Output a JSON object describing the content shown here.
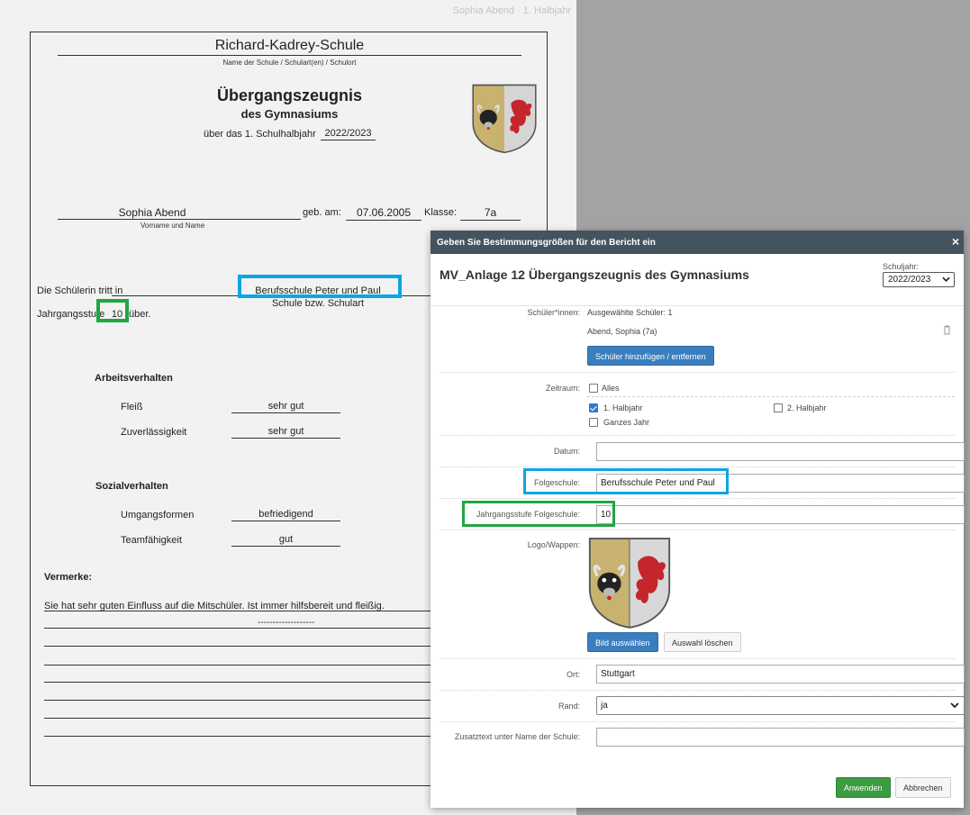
{
  "page_header": "Sophia Abend · 1. Halbjahr",
  "report": {
    "school_name": "Richard-Kadrey-Schule",
    "school_caption": "Name der Schule / Schulart(en) / Schulort",
    "title": "Übergangszeugnis",
    "subtitle": "des Gymnasiums",
    "period_label": "über das 1. Schulhalbjahr",
    "period_value": "2022/2023",
    "student_name": "Sophia Abend",
    "name_caption": "Vorname und Name",
    "birth_label": "geb. am:",
    "birth_value": "07.06.2005",
    "class_label": "Klasse:",
    "class_value": "7a",
    "transfer_label": "Die Schülerin tritt in",
    "transfer_school": "Berufsschule Peter und Paul",
    "transfer_caption": "Schule bzw. Schulart",
    "grade_label": "Jahrgangsstufe",
    "grade_value": "10",
    "grade_suffix": "über.",
    "work_heading": "Arbeitsverhalten",
    "work_items": [
      {
        "label": "Fleiß",
        "value": "sehr gut"
      },
      {
        "label": "Zuverlässigkeit",
        "value": "sehr gut"
      }
    ],
    "social_heading": "Sozialverhalten",
    "social_items": [
      {
        "label": "Umgangsformen",
        "value": "befriedigend"
      },
      {
        "label": "Teamfähigkeit",
        "value": "gut"
      }
    ],
    "remarks_heading": "Vermerke:",
    "remarks_text": "Sie hat sehr guten Einfluss auf die Mitschüler. Ist immer hilfsbereit und fleißig.",
    "remarks_dashes": "-------------------"
  },
  "dialog": {
    "bar_title": "Geben Sie Bestimmungsgrößen für den Bericht ein",
    "close_glyph": "×",
    "title": "MV_Anlage 12 Übergangszeugnis des Gymnasiums",
    "schuljahr_label": "Schuljahr:",
    "schuljahr_value": "2022/2023",
    "students_label": "Schüler*innen:",
    "students_selected": "Ausgewählte Schüler: 1",
    "student_entry": "Abend, Sophia (7a)",
    "students_button": "Schüler hinzufügen / entfernen",
    "zeitraum_label": "Zeitraum:",
    "zeitraum_options": [
      "Alles",
      "1. Halbjahr",
      "2. Halbjahr",
      "Ganzes Jahr"
    ],
    "datum_label": "Datum:",
    "datum_value": "",
    "folgeschule_label": "Folgeschule:",
    "folgeschule_value": "Berufsschule Peter und Paul",
    "jahrgang_label": "Jahrgangsstufe Folgeschule:",
    "jahrgang_value": "10",
    "logo_label": "Logo/Wappen:",
    "select_image_button": "Bild auswählen",
    "clear_selection_button": "Auswahl löschen",
    "ort_label": "Ort:",
    "ort_value": "Stuttgart",
    "rand_label": "Rand:",
    "rand_value": "ja",
    "zusatz_label": "Zusatztext unter Name der Schule:",
    "zusatz_value": "",
    "apply_button": "Anwenden",
    "cancel_button": "Abbrechen"
  },
  "colors": {
    "highlight_blue": "#0ea5e4",
    "highlight_green": "#22a544",
    "dialog_bar": "#44545f",
    "primary_button": "#3a7ebe",
    "apply_button": "#3d9c41"
  }
}
